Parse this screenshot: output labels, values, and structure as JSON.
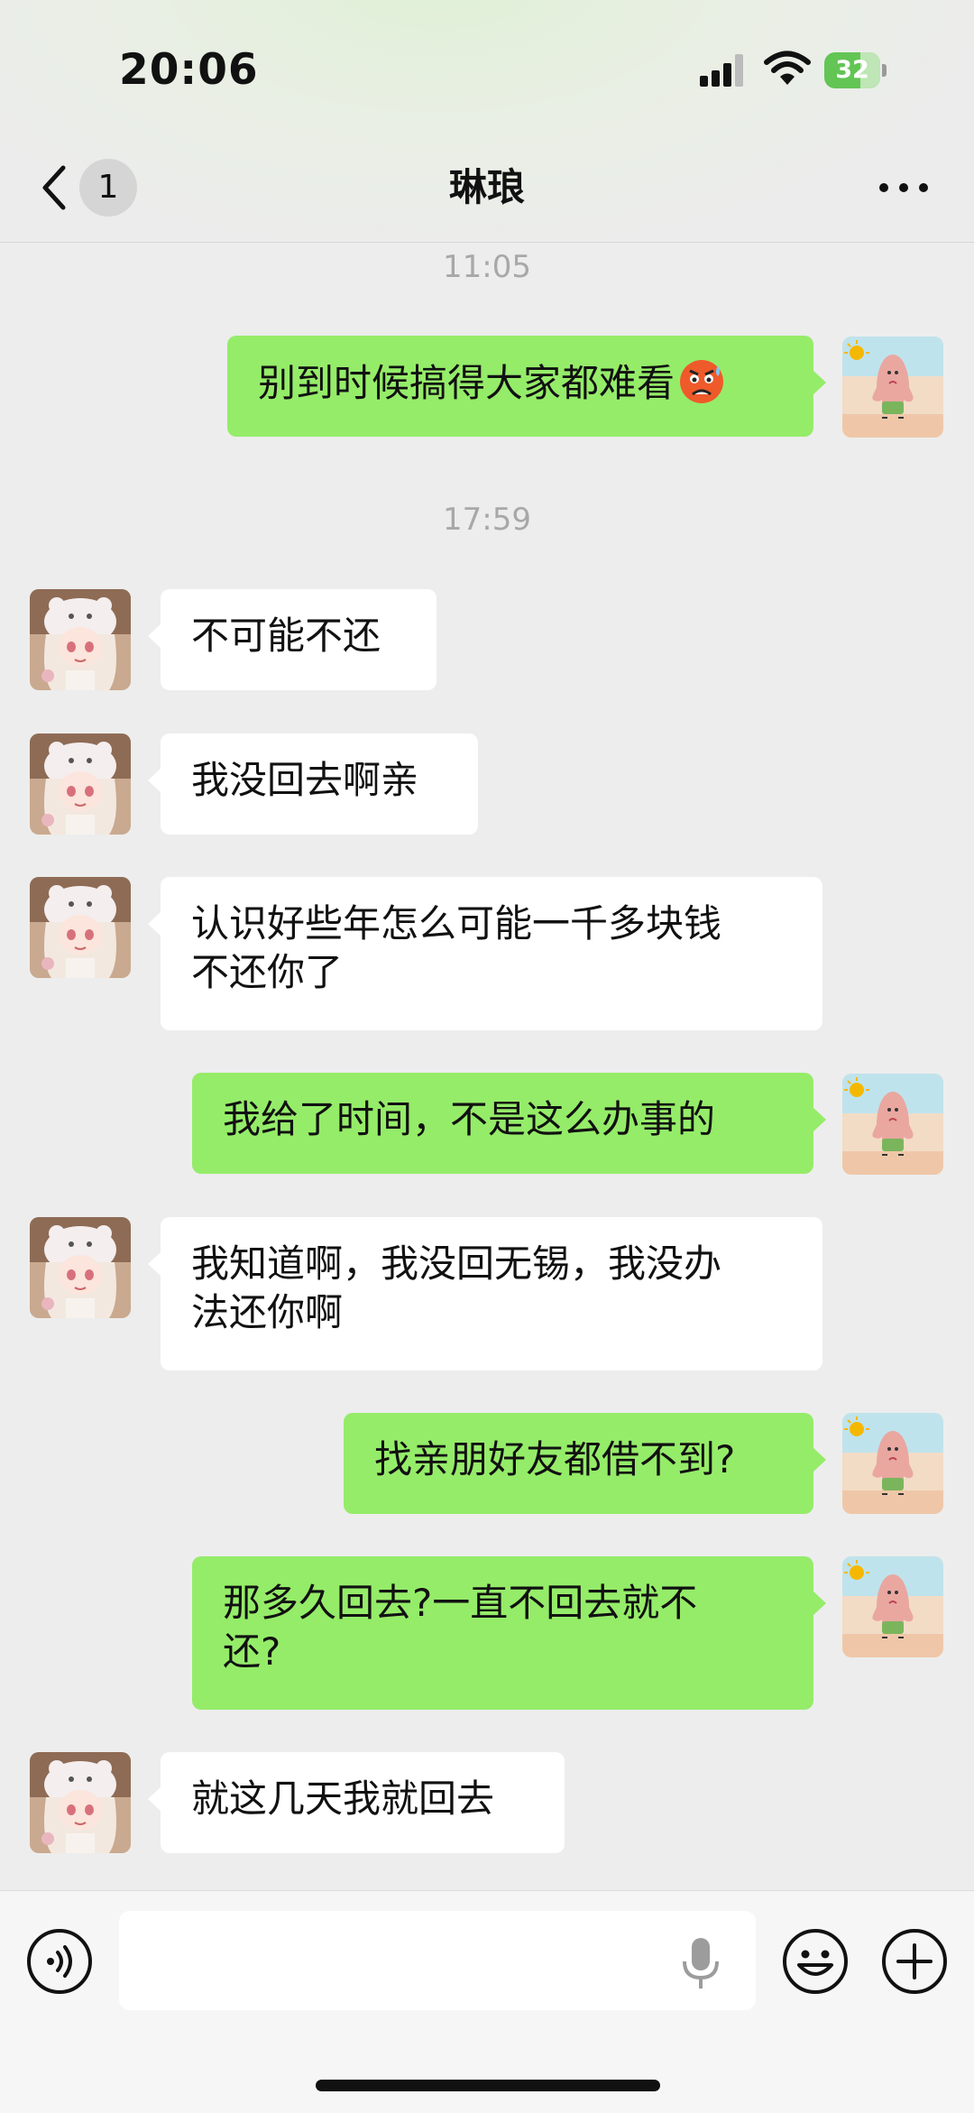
{
  "status_bar": {
    "time": "20:06",
    "battery": "32"
  },
  "nav": {
    "back_icon": "chevron-left-icon",
    "unread_count": "1",
    "title": "琳琅",
    "more_icon": "more-dots-icon"
  },
  "messages": [
    {
      "type": "timestamp",
      "text": "11:05"
    },
    {
      "type": "outgoing",
      "text": "别到时候搞得大家都难看",
      "emoji": "anxious-sweat-emoji"
    },
    {
      "type": "timestamp",
      "text": "17:59"
    },
    {
      "type": "incoming",
      "text": "不可能不还"
    },
    {
      "type": "incoming",
      "text": "我没回去啊亲"
    },
    {
      "type": "incoming",
      "line1": "认识好些年怎么可能一千多块钱",
      "line2": "不还你了"
    },
    {
      "type": "outgoing",
      "text": "我给了时间，不是这么办事的"
    },
    {
      "type": "incoming",
      "line1": "我知道啊，我没回无锡，我没办",
      "line2": "法还你啊"
    },
    {
      "type": "outgoing",
      "text": "找亲朋好友都借不到?"
    },
    {
      "type": "outgoing",
      "line1": "那多久回去?一直不回去就不",
      "line2": "还?"
    },
    {
      "type": "incoming",
      "text": "就这几天我就回去"
    }
  ],
  "input_bar": {
    "voice_icon": "voice-mode-icon",
    "placeholder": "",
    "mic_icon": "microphone-icon",
    "emoji_icon": "emoji-face-icon",
    "plus_icon": "plus-circle-icon"
  },
  "colors": {
    "background": "#ededed",
    "outgoing_bubble": "#95ec69",
    "incoming_bubble": "#ffffff",
    "timestamp": "#a8a8a8",
    "battery": "#62c554"
  }
}
